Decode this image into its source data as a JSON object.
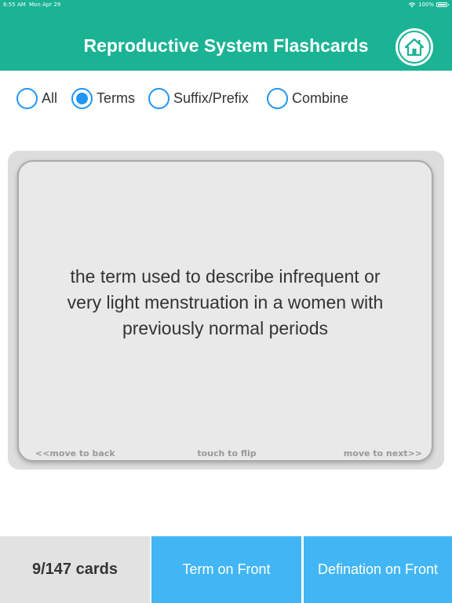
{
  "status_bar": {
    "time": "6:55 AM",
    "date": "Mon Apr 29",
    "battery": "100%"
  },
  "header": {
    "title": "Reproductive System Flashcards",
    "home_icon": "home-icon"
  },
  "filters": [
    {
      "label": "All",
      "selected": false
    },
    {
      "label": "Terms",
      "selected": true
    },
    {
      "label": "Suffix/Prefix",
      "selected": false
    },
    {
      "label": "Combine",
      "selected": false
    }
  ],
  "card": {
    "lines": [
      "the term used to describe infrequent or",
      "very light menstruation in a women with",
      "previously normal periods"
    ],
    "hint_back": "<<move to back",
    "hint_flip": "touch to flip",
    "hint_next": "move to next>>"
  },
  "bottom": {
    "count": "9/147 cards",
    "term_front": "Term on Front",
    "def_front": "Defination on Front"
  },
  "colors": {
    "header": "#1ab394",
    "radio": "#2196f3",
    "button": "#42b6f5"
  }
}
